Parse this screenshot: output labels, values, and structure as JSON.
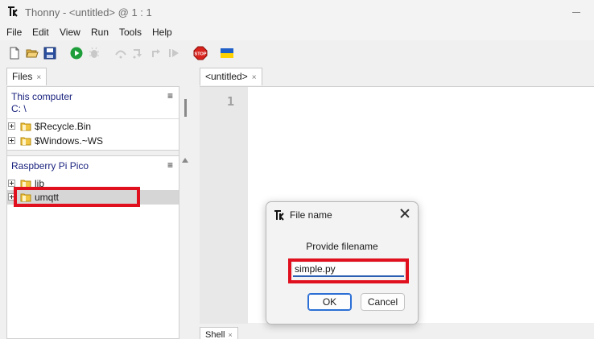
{
  "window": {
    "title": "Thonny  -  <untitled>  @  1 : 1"
  },
  "menu": [
    "File",
    "Edit",
    "View",
    "Run",
    "Tools",
    "Help"
  ],
  "toolbar": {
    "icons": [
      "new-file-icon",
      "open-file-icon",
      "save-icon",
      "run-icon",
      "debug-icon",
      "step-over-icon",
      "step-into-icon",
      "step-out-icon",
      "resume-icon",
      "stop-icon",
      "ukraine-flag-icon"
    ],
    "stop_label": "STOP",
    "colors": {
      "run": "#1e9e3a",
      "stop": "#d9221c",
      "flag_blue": "#1f5fc8",
      "flag_yellow": "#ffd200"
    }
  },
  "files": {
    "tab_label": "Files",
    "tab_close": "×",
    "computer": {
      "title": "This computer",
      "path": "C: \\",
      "menu_glyph": "≡",
      "items": [
        {
          "label": "$Recycle.Bin"
        },
        {
          "label": "$Windows.~WS"
        }
      ]
    },
    "device": {
      "title": "Raspberry Pi Pico",
      "menu_glyph": "≡",
      "items": [
        {
          "label": "lib"
        },
        {
          "label": "umqtt",
          "selected": true
        }
      ]
    }
  },
  "editor": {
    "tab_label": "<untitled>",
    "tab_close": "×",
    "line_numbers": [
      "1"
    ]
  },
  "shell": {
    "tab_label": "Shell",
    "tab_close": "×"
  },
  "dialog": {
    "title": "File name",
    "prompt": "Provide filename",
    "input_value": "simple.py",
    "ok_label": "OK",
    "cancel_label": "Cancel"
  },
  "highlight_color": "#e0101e"
}
